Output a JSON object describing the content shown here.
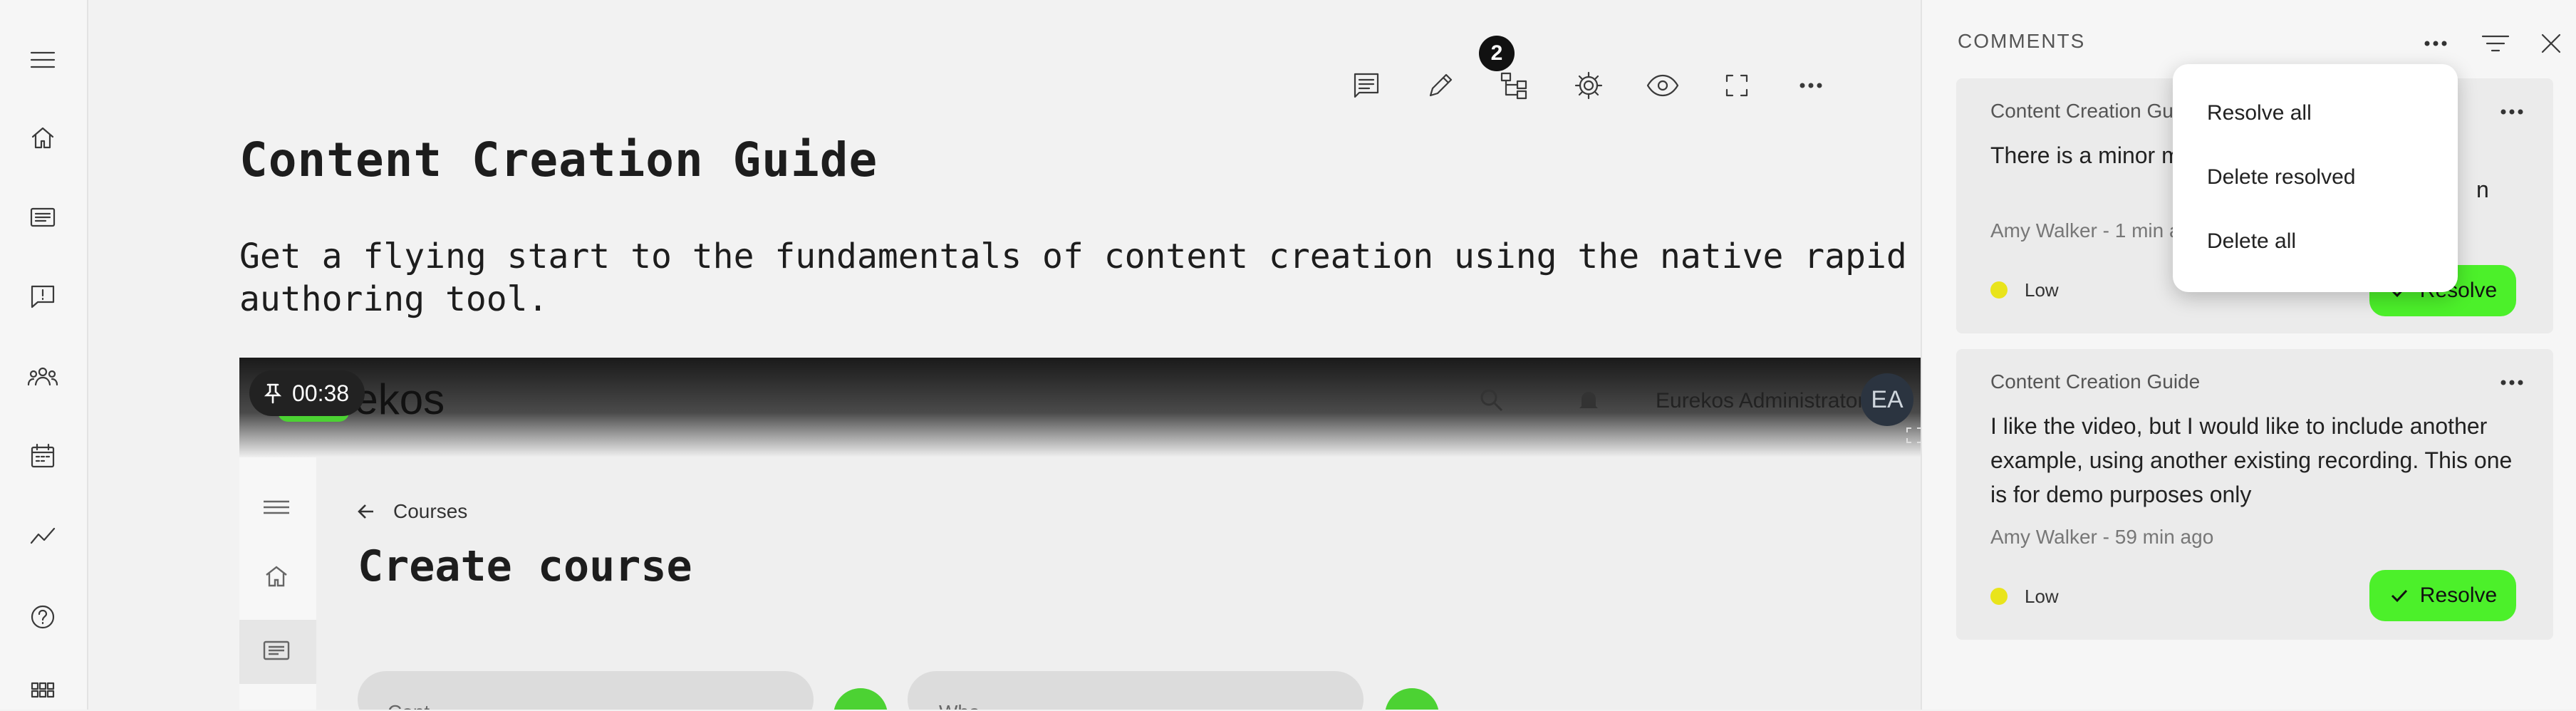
{
  "toolbar": {
    "comment_count": "2"
  },
  "page": {
    "title": "Content Creation Guide",
    "description": "Get a flying start to the fundamentals of content creation using the native rapid authoring tool."
  },
  "video": {
    "timestamp": "00:38",
    "app_logo": "urekos",
    "admin_name": "Eurekos Administrator",
    "avatar_initials": "EA",
    "back_label": "Courses",
    "heading": "Create course",
    "field1_partial": "Cont",
    "field2_partial": "Wha"
  },
  "comments_panel": {
    "title": "COMMENTS",
    "menu": [
      "Resolve all",
      "Delete resolved",
      "Delete all"
    ],
    "items": [
      {
        "source": "Content Creation Guide",
        "text": "There is a minor m please correct the",
        "text_tail": "n",
        "meta": "Amy Walker - 1 min a",
        "priority": "Low",
        "resolve_label": "Resolve"
      },
      {
        "source": "Content Creation Guide",
        "text": "I like the video, but I would like to include another example, using another existing recording. This one is for demo purposes only",
        "meta": "Amy Walker - 59 min ago",
        "priority": "Low",
        "resolve_label": "Resolve"
      }
    ]
  },
  "colors": {
    "accent_green": "#4cf02a",
    "priority_low": "#e9e41b",
    "badge": "#111111"
  }
}
